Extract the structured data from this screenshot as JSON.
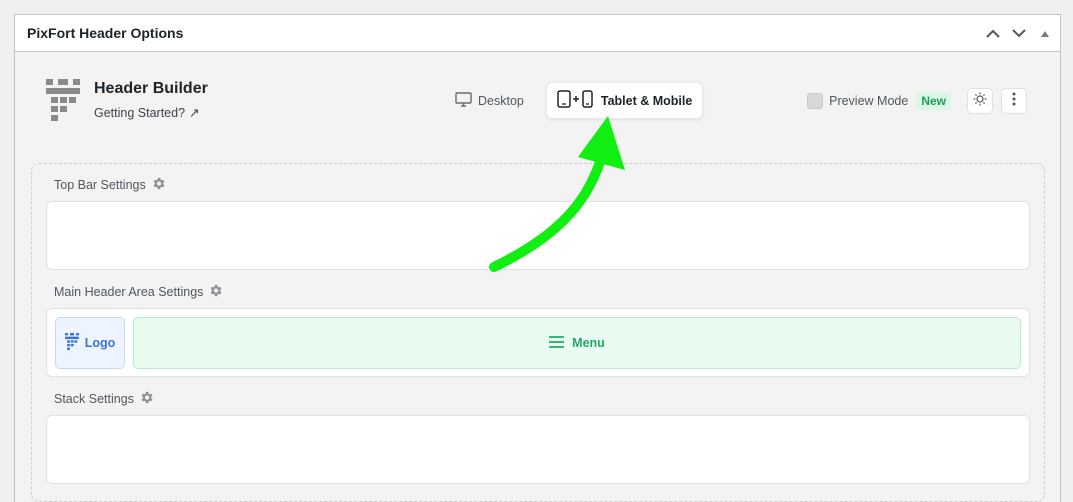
{
  "panel": {
    "title": "PixFort Header Options"
  },
  "brand": {
    "title": "Header Builder",
    "link_label": "Getting Started?",
    "link_arrow": "↗"
  },
  "device_tabs": [
    {
      "label": "Desktop",
      "icon": "monitor-icon",
      "active": false
    },
    {
      "label": "Tablet & Mobile",
      "icon": "tablet-mobile-icon",
      "active": true
    }
  ],
  "preview": {
    "label": "Preview Mode",
    "badge": "New"
  },
  "sections": [
    {
      "label": "Top Bar Settings",
      "elements": []
    },
    {
      "label": "Main Header Area Settings",
      "elements": [
        {
          "label": "Logo",
          "icon": "logo-icon"
        },
        {
          "label": "Menu",
          "icon": "menu-icon"
        }
      ]
    },
    {
      "label": "Stack Settings",
      "elements": []
    }
  ],
  "colors": {
    "accent_arrow": "#11ee11",
    "logo_blue": "#3a73d8",
    "menu_green": "#22a868",
    "badge_green": "#1aa055"
  }
}
